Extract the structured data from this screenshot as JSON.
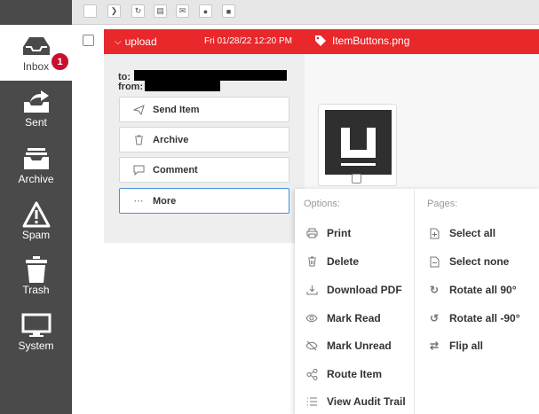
{
  "sidebar": {
    "items": [
      {
        "label": "Inbox",
        "icon": "inbox-icon",
        "badge": "1"
      },
      {
        "label": "Sent",
        "icon": "sent-icon"
      },
      {
        "label": "Archive",
        "icon": "archive-icon"
      },
      {
        "label": "Spam",
        "icon": "spam-warning-icon"
      },
      {
        "label": "Trash",
        "icon": "trash-icon"
      },
      {
        "label": "System",
        "icon": "monitor-icon"
      }
    ]
  },
  "toolbar": {
    "icons": [
      "select-all-checkbox",
      "forward-icon",
      "refresh-icon",
      "archive-icon",
      "mail-icon",
      "comment-icon",
      "video-icon"
    ]
  },
  "message": {
    "subject": "upload",
    "date": "Fri 01/28/22 12:20 PM",
    "attachment": "ItemButtons.png",
    "to_label": "to:",
    "from_label": "from:"
  },
  "actions": {
    "send": "Send Item",
    "archive": "Archive",
    "comment": "Comment",
    "more": "More"
  },
  "dropdown": {
    "options_header": "Options:",
    "pages_header": "Pages:",
    "options": [
      {
        "label": "Print",
        "icon": "print-icon"
      },
      {
        "label": "Delete",
        "icon": "trash-icon"
      },
      {
        "label": "Download PDF",
        "icon": "download-icon"
      },
      {
        "label": "Mark Read",
        "icon": "eye-icon"
      },
      {
        "label": "Mark Unread",
        "icon": "eye-off-icon"
      },
      {
        "label": "Route Item",
        "icon": "share-icon"
      },
      {
        "label": "View Audit Trail",
        "icon": "list-icon"
      }
    ],
    "pages": [
      {
        "label": "Select all",
        "icon": "page-plus-icon"
      },
      {
        "label": "Select none",
        "icon": "page-minus-icon"
      },
      {
        "label": "Rotate all 90°",
        "icon": "rotate-cw-icon"
      },
      {
        "label": "Rotate all -90°",
        "icon": "rotate-ccw-icon"
      },
      {
        "label": "Flip all",
        "icon": "flip-icon"
      }
    ]
  },
  "colors": {
    "accent": "#e8282b",
    "sidebar": "#4a4a4a",
    "badge": "#c8102e"
  }
}
